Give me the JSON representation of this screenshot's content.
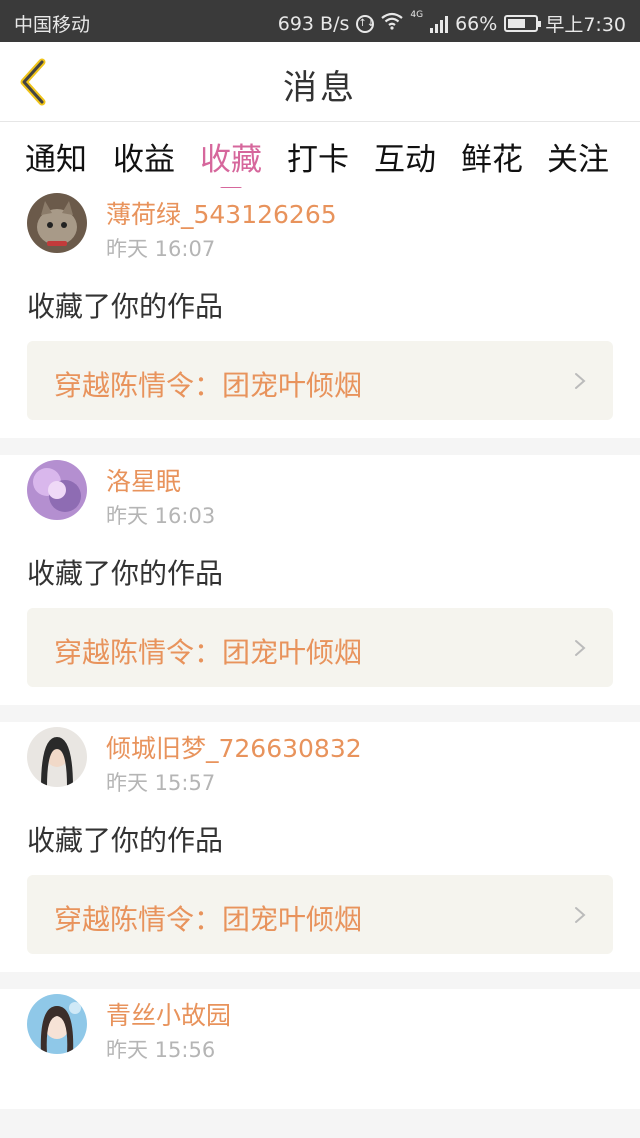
{
  "status_bar": {
    "carrier": "中国移动",
    "speed": "693 B/s",
    "data_badge": "↑↓",
    "network": "4G",
    "battery_level": 0.66,
    "battery": "66%",
    "time": "早上7:30"
  },
  "header": {
    "back_icon": "chevron-left-icon",
    "title": "消息"
  },
  "tabs": [
    {
      "label": "通知"
    },
    {
      "label": "收益"
    },
    {
      "label": "收藏",
      "active": true
    },
    {
      "label": "打卡"
    },
    {
      "label": "互动"
    },
    {
      "label": "鲜花"
    },
    {
      "label": "关注"
    }
  ],
  "colors": {
    "accent_pink": "#d6679c",
    "username_orange": "#e8935c",
    "work_bg": "#f5f4ee"
  },
  "messages": [
    {
      "username": "薄荷绿_543126265",
      "time": "昨天 16:07",
      "action": "收藏了你的作品",
      "work_title": "穿越陈情令：团宠叶倾烟"
    },
    {
      "username": "洛星眠",
      "time": "昨天 16:03",
      "action": "收藏了你的作品",
      "work_title": "穿越陈情令：团宠叶倾烟"
    },
    {
      "username": "倾城旧梦_726630832",
      "time": "昨天 15:57",
      "action": "收藏了你的作品",
      "work_title": "穿越陈情令：团宠叶倾烟"
    },
    {
      "username": "青丝小故园",
      "time": "昨天 15:56"
    }
  ]
}
